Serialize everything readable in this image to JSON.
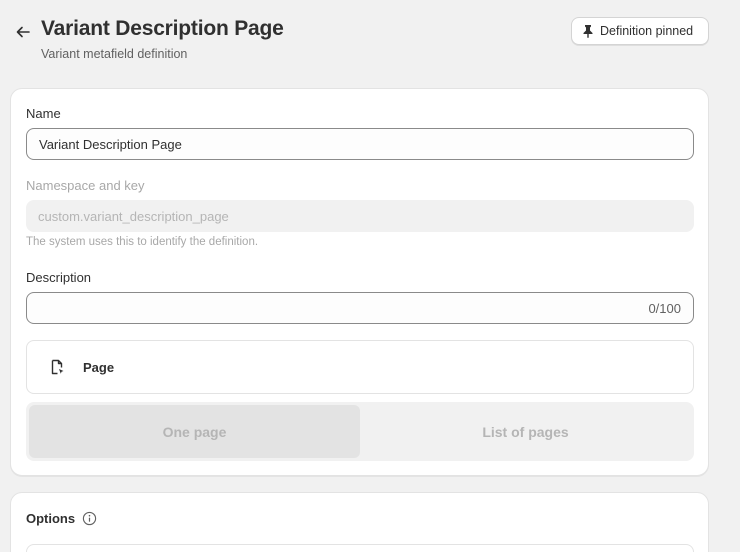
{
  "header": {
    "title": "Variant Description Page",
    "subtitle": "Variant metafield definition",
    "pin_label": "Definition pinned"
  },
  "form": {
    "name_label": "Name",
    "name_value": "Variant Description Page",
    "namespace_label": "Namespace and key",
    "namespace_value": "custom.variant_description_page",
    "namespace_help": "The system uses this to identify the definition.",
    "description_label": "Description",
    "description_value": "",
    "description_counter": "0/100",
    "type_label": "Page",
    "type_options": [
      "One page",
      "List of pages"
    ],
    "selected_type_option": "One page"
  },
  "options": {
    "title": "Options"
  },
  "icons": {
    "back": "arrow-left-icon",
    "pin": "pin-icon",
    "page": "page-icon",
    "info": "info-icon"
  }
}
